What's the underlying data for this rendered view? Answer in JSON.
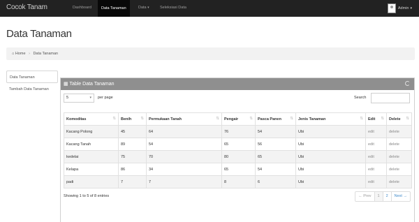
{
  "navbar": {
    "brand": "Cocok Tanam",
    "items": [
      "Dashboard",
      "Data Tanaman",
      "Data",
      "Seleksiasi Data"
    ],
    "user": "Admin"
  },
  "page": {
    "title": "Data Tanaman"
  },
  "breadcrumb": {
    "home": "Home",
    "current": "Data Tanaman"
  },
  "sidebar": {
    "items": [
      "Data Tanaman",
      "Tambah Data Tanaman"
    ]
  },
  "panel": {
    "title": "Table Data Tanaman",
    "page_size": "5",
    "per_page_label": "per page",
    "search_label": "Search",
    "search_value": ""
  },
  "table": {
    "headers": [
      "Komoditas",
      "Benih",
      "Permukaan Tanah",
      "Pengair",
      "Pasca Panen",
      "Jenis Tanaman",
      "Edit",
      "Delete"
    ],
    "rows": [
      [
        "Kacang Polong",
        "45",
        "64",
        "76",
        "54",
        "Ubi",
        "edit",
        "delete"
      ],
      [
        "Kacang Tanah",
        "89",
        "54",
        "65",
        "56",
        "Ubi",
        "edit",
        "delete"
      ],
      [
        "kedelai",
        "75",
        "70",
        "80",
        "65",
        "Ubi",
        "edit",
        "delete"
      ],
      [
        "Kelapa",
        "86",
        "34",
        "65",
        "54",
        "Ubi",
        "edit",
        "delete"
      ],
      [
        "padi",
        "7",
        "7",
        "8",
        "6",
        "Ubi",
        "edit",
        "delete"
      ]
    ]
  },
  "footer": {
    "info": "Showing 1 to 5 of 8 entries",
    "pager": [
      "← Prev",
      "1",
      "2",
      "Next →"
    ]
  }
}
